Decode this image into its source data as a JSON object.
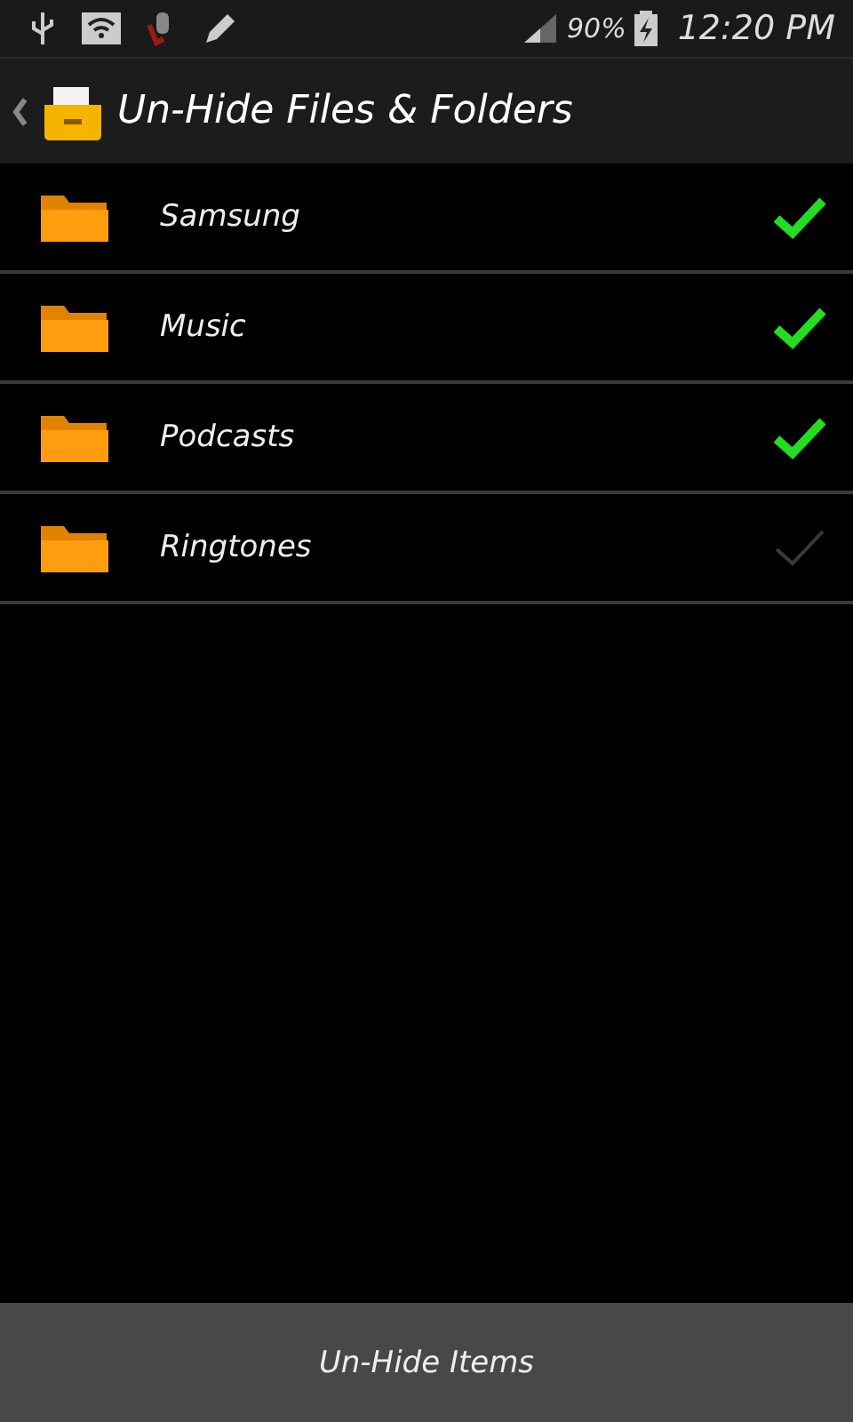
{
  "status_bar": {
    "battery": "90%",
    "time": "12:20 PM"
  },
  "header": {
    "title": "Un-Hide Files & Folders"
  },
  "folders": [
    {
      "name": "Samsung",
      "checked": true
    },
    {
      "name": "Music",
      "checked": true
    },
    {
      "name": "Podcasts",
      "checked": true
    },
    {
      "name": "Ringtones",
      "checked": false
    }
  ],
  "action_button": "Un-Hide Items"
}
